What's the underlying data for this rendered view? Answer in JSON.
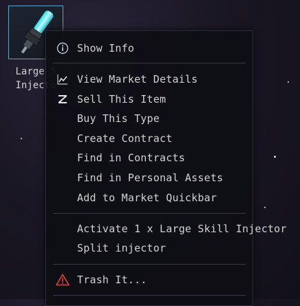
{
  "item": {
    "name_line1": "Large S",
    "name_line2": "Injecto",
    "icon": "skill-injector-icon"
  },
  "context_menu": {
    "groups": [
      [
        {
          "label": "Show Info",
          "icon": "info-icon"
        }
      ],
      [
        {
          "label": "View Market Details",
          "icon": "market-chart-icon"
        },
        {
          "label": "Sell This Item",
          "icon": "sell-z-icon"
        },
        {
          "label": "Buy This Type",
          "icon": ""
        },
        {
          "label": "Create Contract",
          "icon": ""
        },
        {
          "label": "Find in Contracts",
          "icon": ""
        },
        {
          "label": "Find in Personal Assets",
          "icon": ""
        },
        {
          "label": "Add to Market Quickbar",
          "icon": ""
        }
      ],
      [
        {
          "label": "Activate 1 x Large Skill Injector",
          "icon": ""
        },
        {
          "label": "Split injector",
          "icon": ""
        }
      ],
      [
        {
          "label": "Trash It...",
          "icon": "warning-icon"
        }
      ]
    ]
  },
  "colors": {
    "accent_border": "#5ea3c8",
    "warning": "#d23a3a",
    "text": "#d2d2d2"
  }
}
